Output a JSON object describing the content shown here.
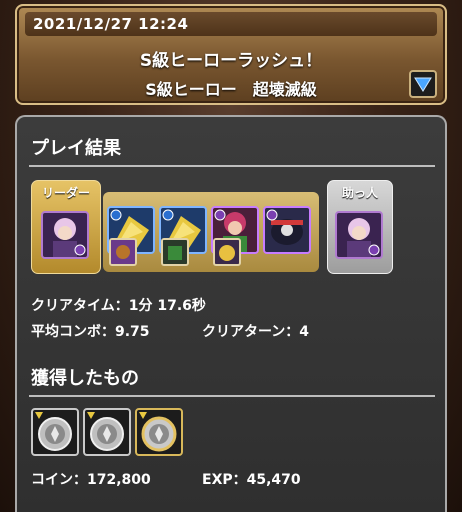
{
  "header": {
    "datetime": "2021/12/27 12:24",
    "title": "S級ヒーローラッシュ！",
    "subtitle": "S級ヒーロー　超壊滅級",
    "dropdown_icon": "triangle-down-icon"
  },
  "results": {
    "section_title": "プレイ結果",
    "leader_label": "リーダー",
    "helper_label": "助っ人",
    "clear_time": "クリアタイム：1分 17.6秒",
    "avg_combo": "平均コンボ：9.75",
    "clear_turns": "クリアターン：4"
  },
  "rewards": {
    "section_title": "獲得したもの",
    "coins": "コイン：172,800",
    "exp": "EXP：45,470"
  },
  "colors": {
    "header_gold": "#b08a54",
    "panel_bg": "#3c3c3c",
    "leader_frame": "#e6c366",
    "helper_frame": "#d7d7d7",
    "dark_attribute": "#7a3fb0",
    "wood_attribute": "#3a8a3a",
    "water_attribute": "#2a6fd0"
  }
}
